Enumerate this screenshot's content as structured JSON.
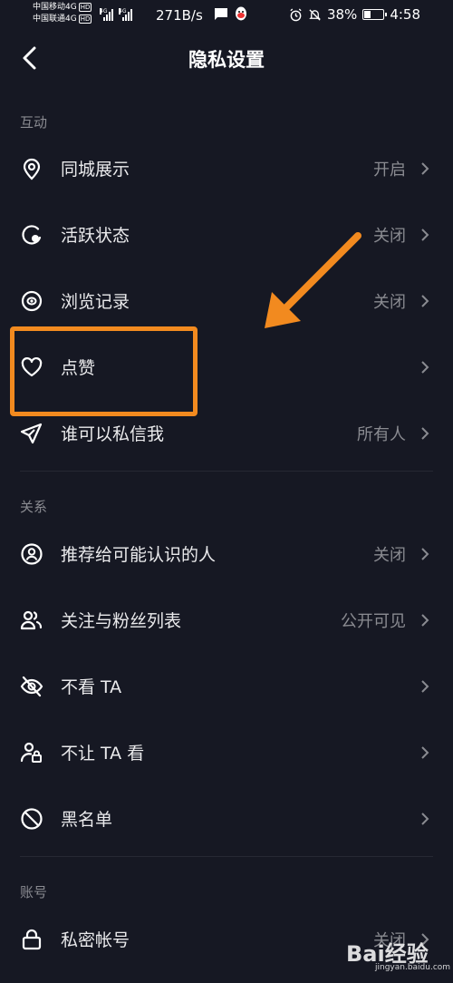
{
  "status_bar": {
    "carrier1": "中国移动4G",
    "carrier2": "中国联通4G",
    "hd": "HD",
    "net1": "4G",
    "net2": "4G",
    "speed": "271B/s",
    "battery_percent": "38%",
    "battery_level": 0.38,
    "time": "4:58"
  },
  "header": {
    "title": "隐私设置"
  },
  "sections": {
    "interaction": "互动",
    "relation": "关系",
    "account": "账号"
  },
  "rows": {
    "nearby": {
      "label": "同城展示",
      "value": "开启",
      "icon": "location-pin-icon"
    },
    "active_status": {
      "label": "活跃状态",
      "value": "关闭",
      "icon": "active-status-icon"
    },
    "browse_history": {
      "label": "浏览记录",
      "value": "关闭",
      "icon": "eye-icon"
    },
    "likes": {
      "label": "点赞",
      "value": "",
      "icon": "heart-icon"
    },
    "messages": {
      "label": "谁可以私信我",
      "value": "所有人",
      "icon": "send-icon"
    },
    "recommend": {
      "label": "推荐给可能认识的人",
      "value": "关闭",
      "icon": "user-circle-icon"
    },
    "follow_list": {
      "label": "关注与粉丝列表",
      "value": "公开可见",
      "icon": "users-icon"
    },
    "not_see": {
      "label": "不看 TA",
      "value": "",
      "icon": "eye-off-icon"
    },
    "not_let_see": {
      "label": "不让 TA 看",
      "value": "",
      "icon": "user-lock-icon"
    },
    "blacklist": {
      "label": "黑名单",
      "value": "",
      "icon": "block-icon"
    },
    "private_account": {
      "label": "私密帐号",
      "value": "关闭",
      "icon": "lock-icon"
    }
  },
  "annotation_color": "#f28a1f",
  "watermark": {
    "brand": "Bai经验",
    "url": "jingyan.baidu.com"
  }
}
